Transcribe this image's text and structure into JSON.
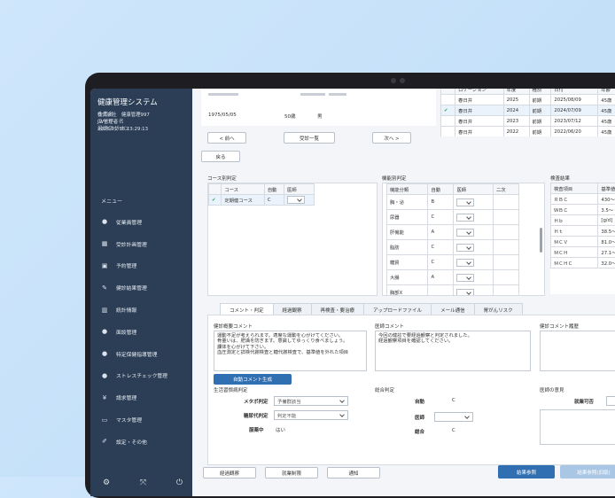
{
  "app": {
    "title": "健康管理システム"
  },
  "user_info": {
    "company_label": "企業名",
    "company": "株式会社　健康管理997",
    "user_label": "ユーザー名",
    "user": "JW管理者",
    "last_login_label": "最終ログイン",
    "last_login": "2026/01/18 13:29:13"
  },
  "menu": {
    "heading": "メニュー",
    "items": [
      {
        "label": "従業員管理",
        "icon": "person-icon",
        "glyph": "●"
      },
      {
        "label": "受診計画管理",
        "icon": "calendar-icon",
        "glyph": "▦"
      },
      {
        "label": "予約管理",
        "icon": "calendar-check-icon",
        "glyph": "▣"
      },
      {
        "label": "健診結果管理",
        "icon": "clipboard-icon",
        "glyph": "✎"
      },
      {
        "label": "統計情報",
        "icon": "bar-chart-icon",
        "glyph": "▥"
      },
      {
        "label": "面談管理",
        "icon": "user-chat-icon",
        "glyph": "●"
      },
      {
        "label": "特定保健指導管理",
        "icon": "user-group-icon",
        "glyph": "●"
      },
      {
        "label": "ストレスチェック管理",
        "icon": "person-stress-icon",
        "glyph": "●"
      },
      {
        "label": "請求管理",
        "icon": "yen-icon",
        "glyph": "¥"
      },
      {
        "label": "マスタ管理",
        "icon": "monitor-icon",
        "glyph": "▭"
      },
      {
        "label": "設定・その他",
        "icon": "wrench-icon",
        "glyph": "✐"
      }
    ]
  },
  "bottom_icons": [
    "gear-icon",
    "expand-icon",
    "power-icon"
  ],
  "person": {
    "birthdate": "1975/05/05",
    "age": "50歳",
    "sex": "男"
  },
  "history": {
    "headers": [
      "ロケーション",
      "年度",
      "種別",
      "日付",
      "年齢",
      "区分"
    ],
    "rows": [
      {
        "check": "",
        "loc": "春日井",
        "year": "2025",
        "kind": "前期",
        "date": "2025/08/09",
        "age": "45歳",
        "cls": "定期"
      },
      {
        "check": "✔",
        "loc": "春日井",
        "year": "2024",
        "kind": "前期",
        "date": "2024/07/09",
        "age": "45歳",
        "cls": "定期"
      },
      {
        "check": "",
        "loc": "春日井",
        "year": "2023",
        "kind": "前期",
        "date": "2023/07/12",
        "age": "45歳",
        "cls": "定期"
      },
      {
        "check": "",
        "loc": "春日井",
        "year": "2022",
        "kind": "前期",
        "date": "2022/06/20",
        "age": "45歳",
        "cls": "定期"
      }
    ]
  },
  "nav": {
    "prev": "< 前へ",
    "list": "受診一覧",
    "next": "次へ >",
    "back": "戻る"
  },
  "course": {
    "title": "コース別判定",
    "headers": [
      "コース",
      "自動",
      "医師"
    ],
    "rows": [
      {
        "check": "✔",
        "course": "定期健コース",
        "auto": "C"
      }
    ]
  },
  "function": {
    "title": "機能別判定",
    "headers": [
      "機能分類",
      "自動",
      "医師",
      "二次"
    ],
    "rows": [
      {
        "name": "胸・泌",
        "auto": "B"
      },
      {
        "name": "尿器",
        "auto": "C"
      },
      {
        "name": "肝機能",
        "auto": "A"
      },
      {
        "name": "脂肪",
        "auto": "C"
      },
      {
        "name": "糖質",
        "auto": "C"
      },
      {
        "name": "大腸",
        "auto": "A"
      },
      {
        "name": "胸部X",
        "auto": ""
      }
    ]
  },
  "exam": {
    "title": "検査結果",
    "headers": [
      "検査項目",
      "基準値"
    ],
    "rows": [
      {
        "item": "ＲＢＣ",
        "ref": "430～"
      },
      {
        "item": "ＷＢＣ",
        "ref": "3.5～"
      },
      {
        "item": "Ｈｂ",
        "ref": "[g/d]"
      },
      {
        "item": "Ｈｔ",
        "ref": "38.5～"
      },
      {
        "item": "ＭＣＶ",
        "ref": "81.0～"
      },
      {
        "item": "ＭＣＨ",
        "ref": "27.1～"
      },
      {
        "item": "ＭＣＨＣ",
        "ref": "32.0～"
      }
    ]
  },
  "tabs": [
    "コメント・判定",
    "経過観察",
    "再検査・要治療",
    "アップロードファイル",
    "メール通信",
    "胃がんリスク"
  ],
  "comments": {
    "auto_title": "健診概要コメント",
    "auto_text": "運動不足が考えられます。適度な運動を心がけてください。\n骨量いは、肥満を防ぎます。意識してゆっくり食べましょう。\n課体を心がけて下さい。\n血圧測定と詳検代謝検査と糖代謝検査で、基準値を外れた項目",
    "auto_button": "自動コメント生成",
    "doctor_title": "医師コメント",
    "doctor_text": "今回の健診で要経過観察と判定されました。\n経過観察項目を確認してください。",
    "history_title": "健診コメント履歴"
  },
  "lifestyle": {
    "title": "生活習慣病判定",
    "metabo_label": "メタボ判定",
    "metabo_value": "予備群該当",
    "carbs_label": "糖尿代判定",
    "carbs_value": "判定不能",
    "smoke_label": "服薬中",
    "smoke_value": "はい"
  },
  "overall": {
    "title": "総合判定",
    "auto_label": "自動",
    "auto_value": "C",
    "doctor_label": "医師",
    "grade_label": "総合",
    "grade_value": "C"
  },
  "opinion": {
    "title": "医師の意見",
    "work_label": "就業可否"
  },
  "footer": {
    "btn1": "経過観察",
    "btn2": "就業制限",
    "btn3": "通知",
    "report": "結果参照",
    "report2": "結果参照(旧版)"
  }
}
